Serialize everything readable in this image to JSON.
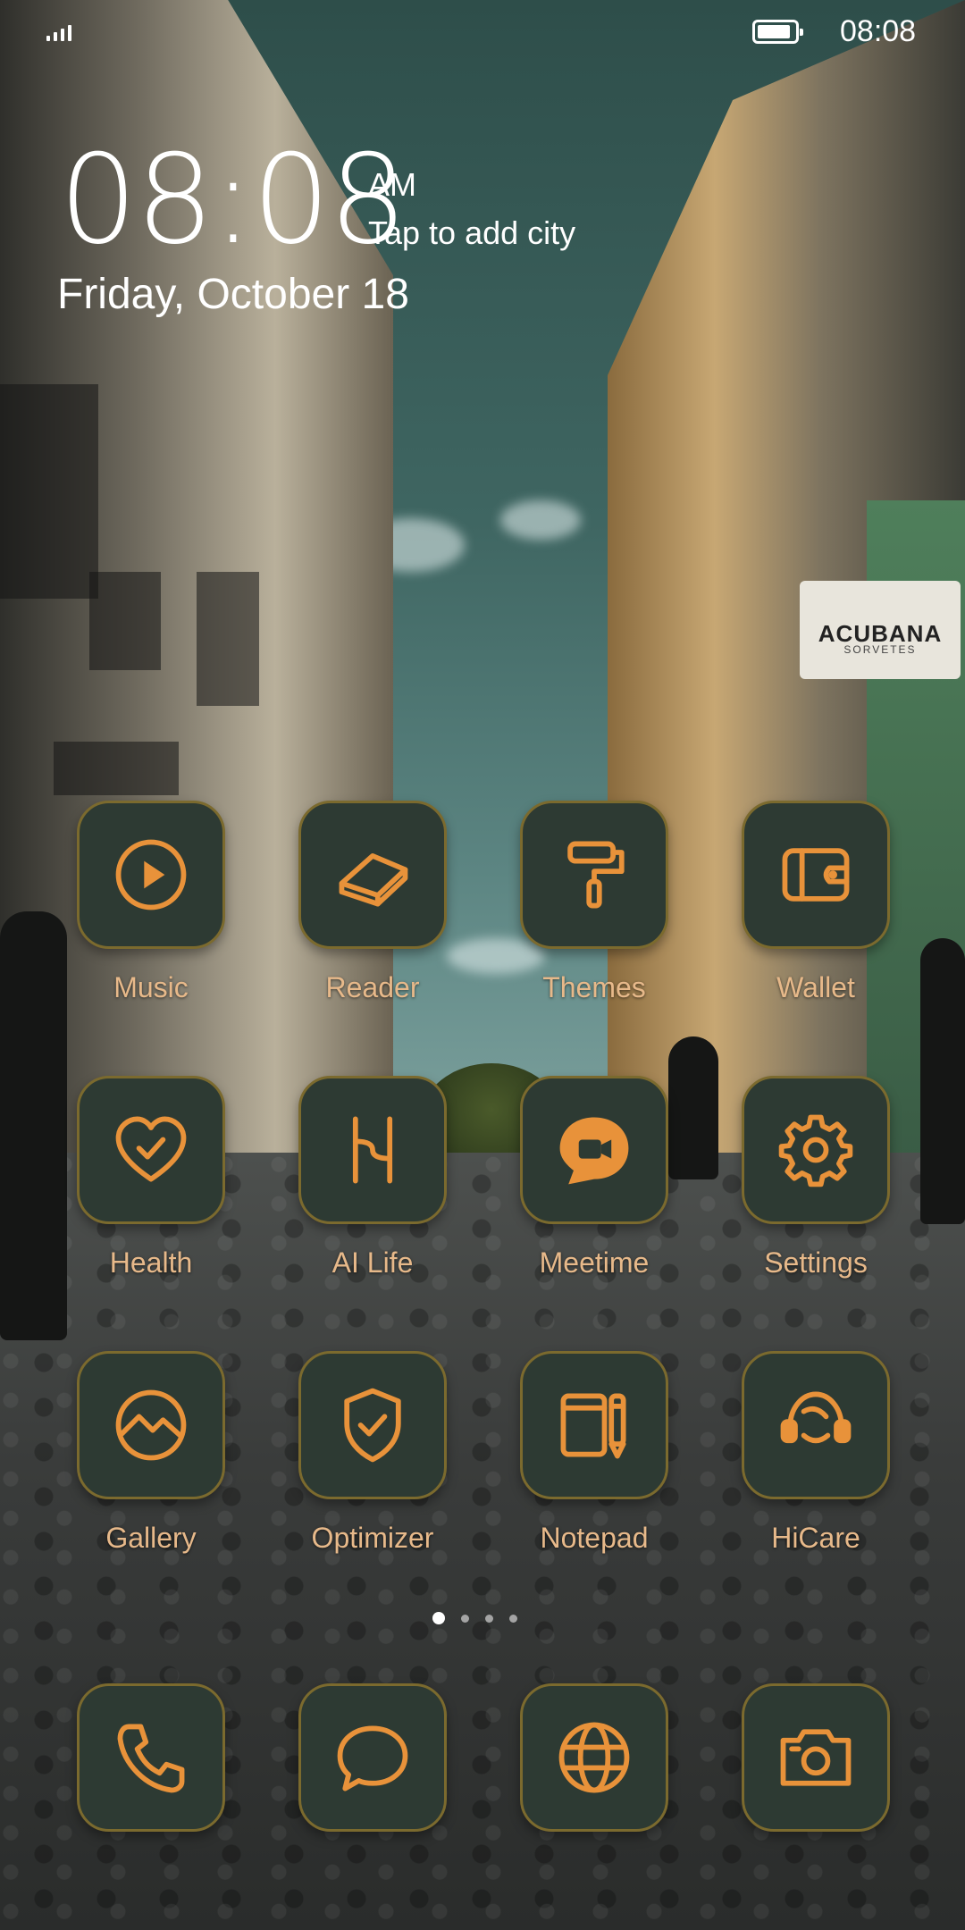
{
  "status_bar": {
    "time": "08:08",
    "battery_level": 0.9,
    "signal_icon": "signal-bars-icon",
    "battery_icon": "battery-icon"
  },
  "clock_widget": {
    "time": "08:08",
    "ampm": "AM",
    "city_prompt": "Tap to add city",
    "date": "Friday, October 18"
  },
  "wallpaper": {
    "sign_title": "ACUBANA",
    "sign_subtitle": "SORVETES"
  },
  "theme": {
    "tile_bg": "#2d3a33",
    "tile_border": "#7b6a2e",
    "icon_color": "#e8923a",
    "label_color": "#e7b98a"
  },
  "apps": [
    {
      "label": "Music",
      "icon": "play-circle-icon"
    },
    {
      "label": "Reader",
      "icon": "book-icon"
    },
    {
      "label": "Themes",
      "icon": "paint-roller-icon"
    },
    {
      "label": "Wallet",
      "icon": "wallet-icon"
    },
    {
      "label": "Health",
      "icon": "heart-check-icon"
    },
    {
      "label": "AI Life",
      "icon": "ai-life-icon"
    },
    {
      "label": "Meetime",
      "icon": "video-chat-icon"
    },
    {
      "label": "Settings",
      "icon": "gear-icon"
    },
    {
      "label": "Gallery",
      "icon": "gallery-icon"
    },
    {
      "label": "Optimizer",
      "icon": "shield-check-icon"
    },
    {
      "label": "Notepad",
      "icon": "notepad-icon"
    },
    {
      "label": "HiCare",
      "icon": "headset-icon"
    }
  ],
  "page_indicator": {
    "total": 4,
    "active": 1
  },
  "dock": [
    {
      "icon": "phone-icon"
    },
    {
      "icon": "message-icon"
    },
    {
      "icon": "browser-globe-icon"
    },
    {
      "icon": "camera-icon"
    }
  ]
}
